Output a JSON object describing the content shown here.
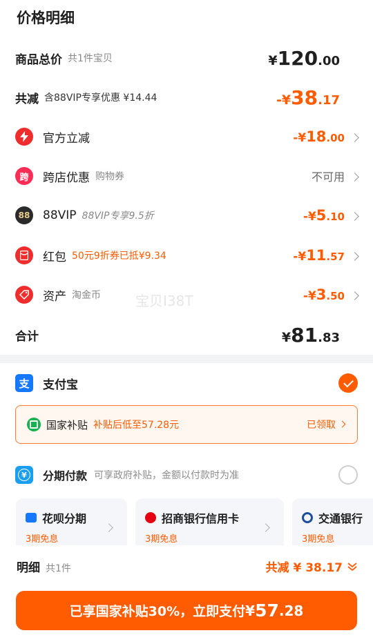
{
  "title": "价格明细",
  "goods_total": {
    "label": "商品总价",
    "sub": "共1件宝贝",
    "yen": "¥",
    "int": "120",
    "dec": ".00"
  },
  "reduction": {
    "label": "共减",
    "sub": "含88VIP专享优惠 ¥14.44",
    "prefix": "-¥",
    "int": "38",
    "dec": ".17"
  },
  "discounts": [
    {
      "icon": "lightning-icon",
      "icon_color": "#f02d2d",
      "label": "官方立减",
      "sub": "",
      "prefix": "-¥",
      "int": "18",
      "dec": ".00"
    },
    {
      "icon": "cross-store-icon",
      "icon_glyph": "跨",
      "icon_color": "#ff2d55",
      "label": "跨店优惠",
      "sub": "购物券",
      "text_value": "不可用"
    },
    {
      "icon": "vip88-icon",
      "icon_glyph": "88",
      "icon_color": "#2b2b2b",
      "label": "88VIP",
      "sub": "88VIP专享9.5折",
      "prefix": "-¥",
      "int": "5",
      "dec": ".10"
    },
    {
      "icon": "red-packet-icon",
      "icon_color": "#f02d2d",
      "label": "红包",
      "sub": "50元9折券已抵¥9.34",
      "prefix": "-¥",
      "int": "11",
      "dec": ".57"
    },
    {
      "icon": "tag-icon",
      "icon_color": "#f02d2d",
      "label": "资产",
      "sub": "淘金币",
      "prefix": "-¥",
      "int": "3",
      "dec": ".50"
    }
  ],
  "total": {
    "label": "合计",
    "yen": "¥",
    "int": "81",
    "dec": ".83"
  },
  "watermark": "宝贝I38T",
  "alipay": {
    "icon_glyph": "支",
    "label": "支付宝"
  },
  "subsidy": {
    "text": "国家补贴",
    "note": "补贴后低至57.28元",
    "action": "已领取"
  },
  "installment": {
    "icon_glyph": "¥",
    "label": "分期付款",
    "note": "可享政府补贴，金额以付款时为准"
  },
  "cards": [
    {
      "icon": "huabei-icon",
      "label": "花呗分期",
      "note": "3期免息"
    },
    {
      "icon": "cmb-icon",
      "label": "招商银行信用卡",
      "note": "3期免息"
    },
    {
      "icon": "bocom-icon",
      "label": "交通银行",
      "note": "3期免息"
    }
  ],
  "detail": {
    "label": "明细",
    "count": "共1件",
    "reduction": "共减 ¥ 38.17"
  },
  "cta": {
    "text": "已享国家补贴30%，立即支付",
    "yen": "¥",
    "int": "57",
    "dec": ".28"
  },
  "colors": {
    "accent": "#ff5b00",
    "alipay": "#1677ff",
    "divider": "#f2f3f5"
  }
}
